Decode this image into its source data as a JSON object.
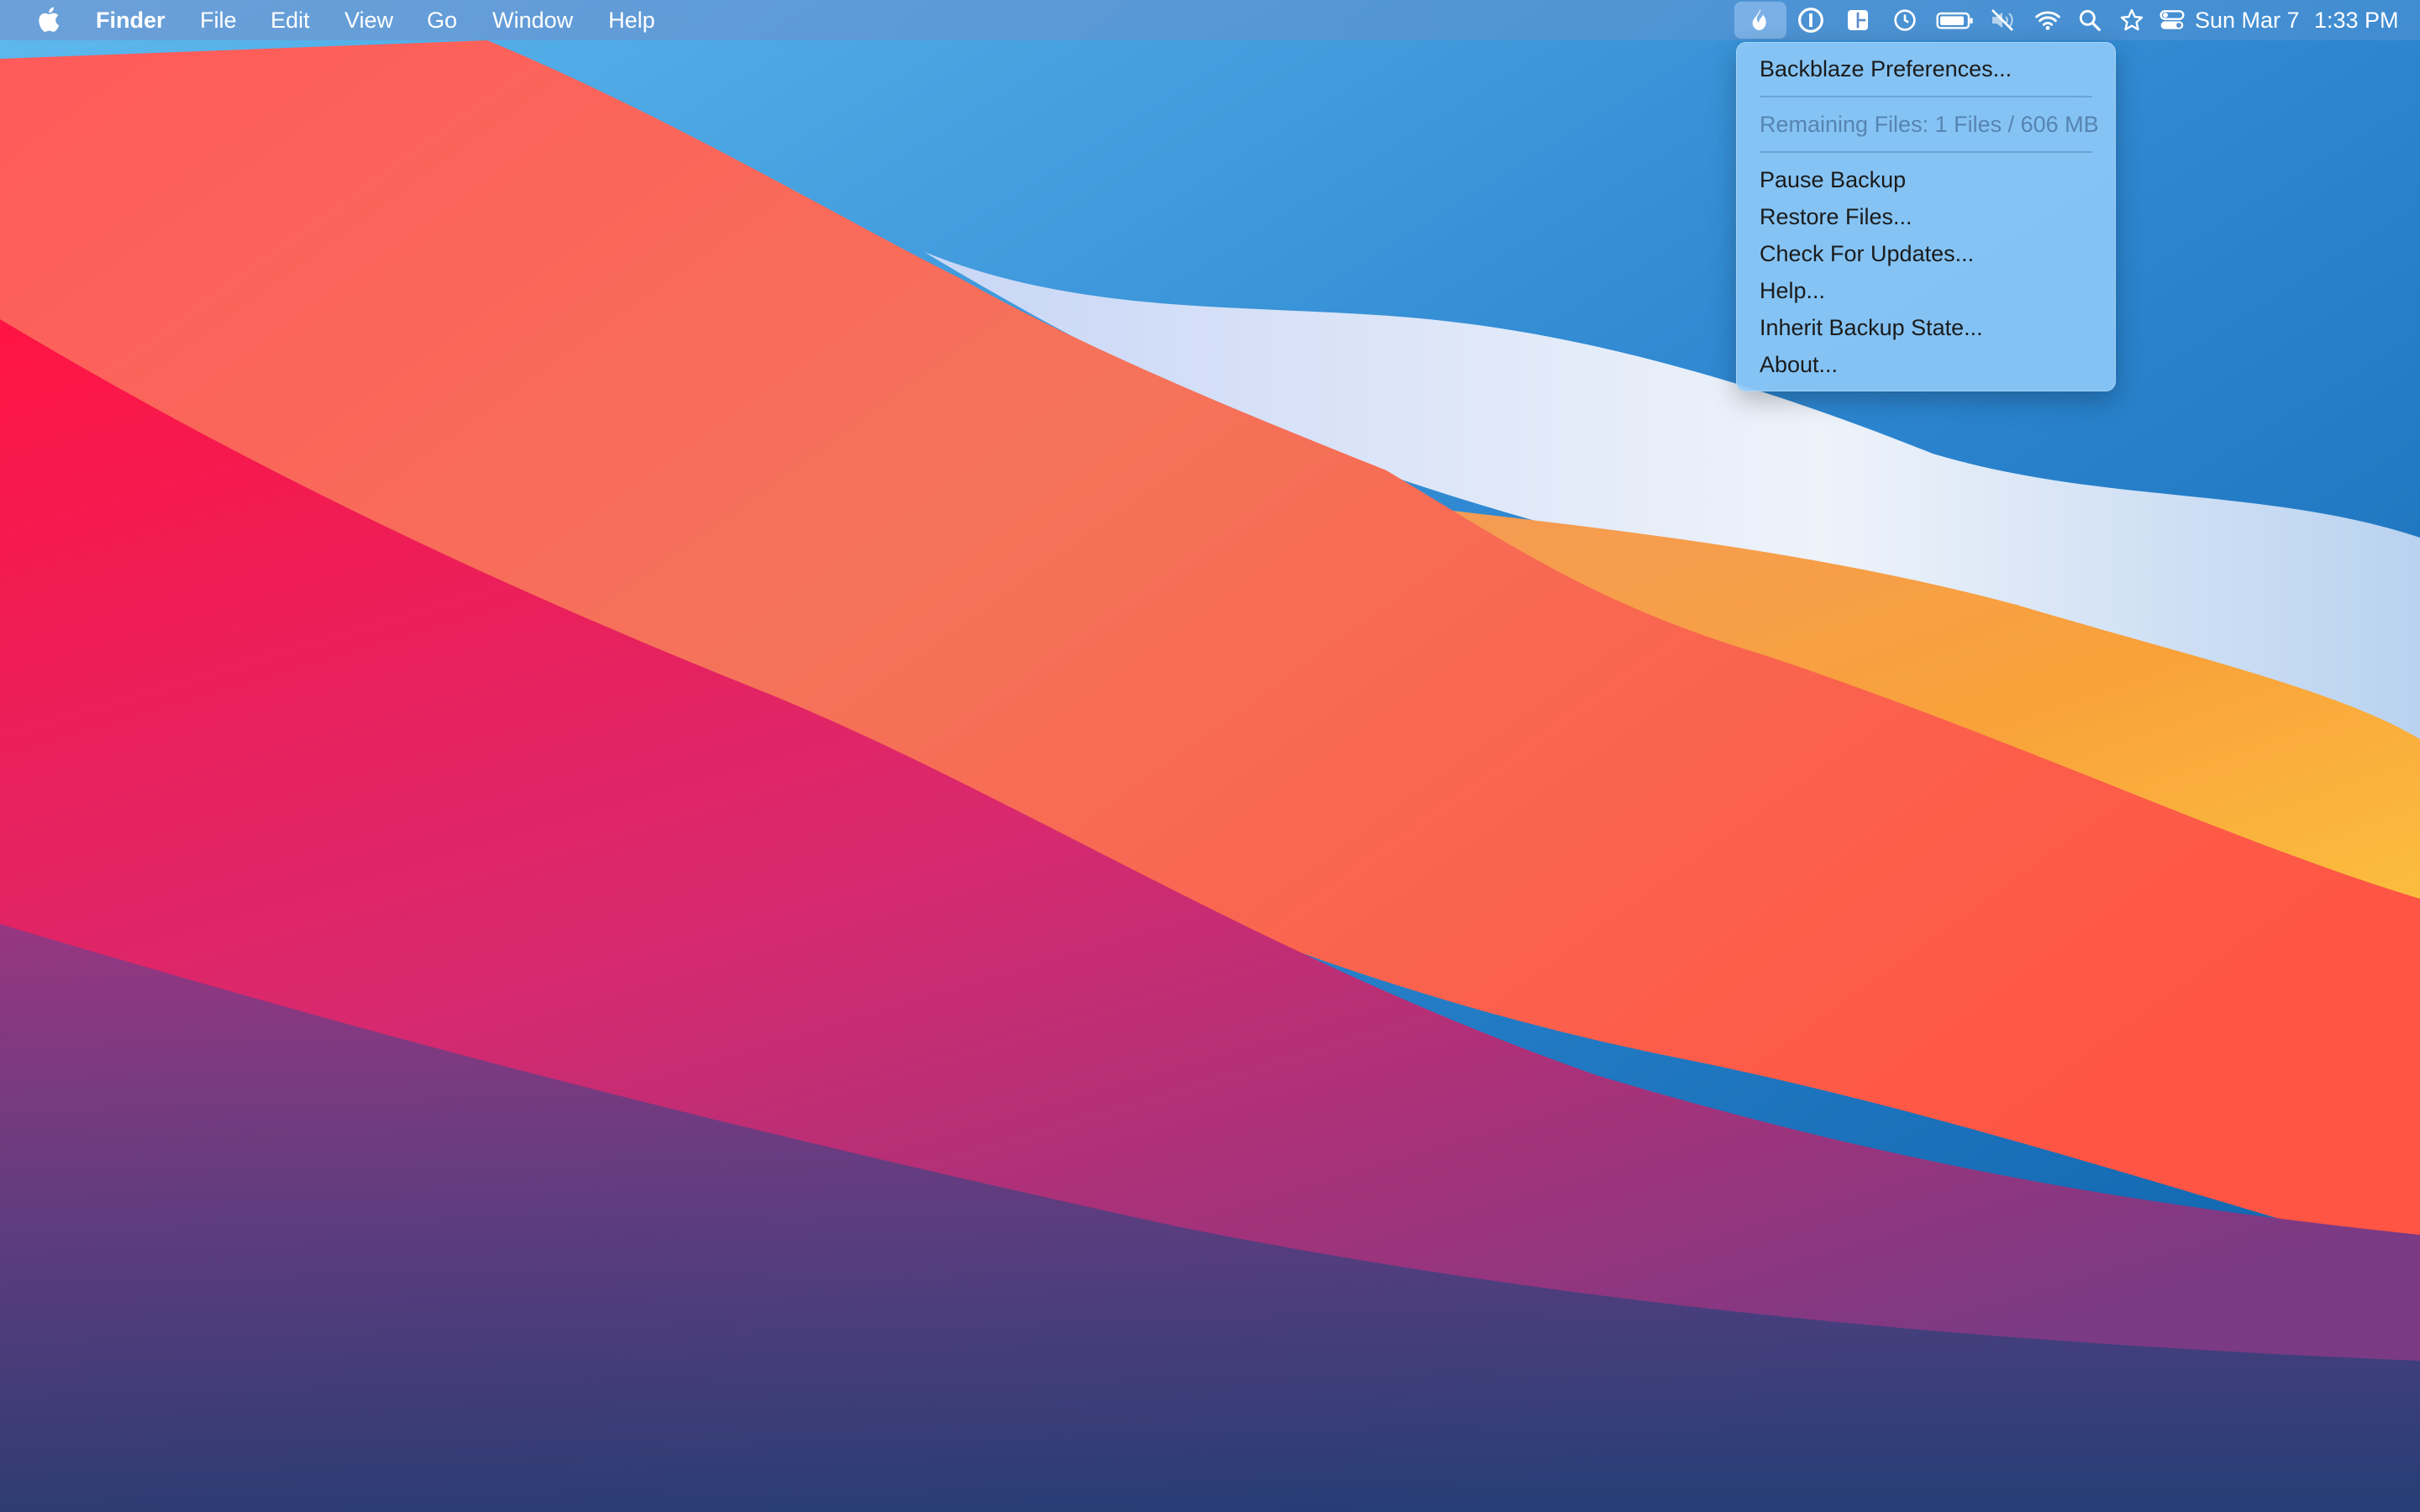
{
  "menubar": {
    "app_name": "Finder",
    "menus": [
      "File",
      "Edit",
      "View",
      "Go",
      "Window",
      "Help"
    ],
    "status_icons": [
      "backblaze-icon",
      "1password-icon",
      "magnet-icon",
      "time-machine-icon",
      "battery-icon",
      "mute-icon",
      "wifi-icon",
      "spotlight-icon",
      "star-icon",
      "control-center-icon"
    ],
    "date": "Sun Mar 7",
    "time": "1:33 PM"
  },
  "dropdown": {
    "preferences": "Backblaze Preferences...",
    "remaining_files": "Remaining Files: 1 Files / 606 MB",
    "items": [
      "Pause Backup",
      "Restore Files...",
      "Check For Updates...",
      "Help...",
      "Inherit Backup State...",
      "About..."
    ]
  },
  "colors": {
    "menu_background": "#8cc8f6",
    "wallpaper_red": "#f5334f",
    "wallpaper_orange": "#f9a23a",
    "wallpaper_blue": "#2d86d0"
  }
}
